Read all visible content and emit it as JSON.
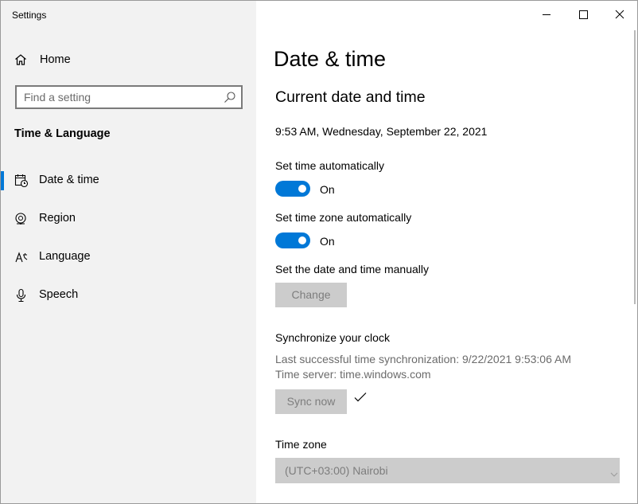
{
  "window": {
    "title": "Settings"
  },
  "sidebar": {
    "home_label": "Home",
    "search_placeholder": "Find a setting",
    "section_title": "Time & Language",
    "items": [
      {
        "label": "Date & time",
        "icon": "calendar-clock-icon",
        "selected": true
      },
      {
        "label": "Region",
        "icon": "globe-icon",
        "selected": false
      },
      {
        "label": "Language",
        "icon": "language-icon",
        "selected": false
      },
      {
        "label": "Speech",
        "icon": "microphone-icon",
        "selected": false
      }
    ]
  },
  "main": {
    "page_title": "Date & time",
    "subheading": "Current date and time",
    "current_datetime": "9:53 AM, Wednesday, September 22, 2021",
    "set_time_auto": {
      "label": "Set time automatically",
      "state": "On"
    },
    "set_tz_auto": {
      "label": "Set time zone automatically",
      "state": "On"
    },
    "manual": {
      "label": "Set the date and time manually",
      "button": "Change"
    },
    "sync": {
      "heading": "Synchronize your clock",
      "last_sync": "Last successful time synchronization: 9/22/2021 9:53:06 AM",
      "server": "Time server: time.windows.com",
      "button": "Sync now"
    },
    "timezone": {
      "label": "Time zone",
      "value": "(UTC+03:00) Nairobi"
    }
  },
  "colors": {
    "accent": "#0078d7",
    "sidebar_bg": "#f2f2f2",
    "disabled_bg": "#cccccc"
  }
}
